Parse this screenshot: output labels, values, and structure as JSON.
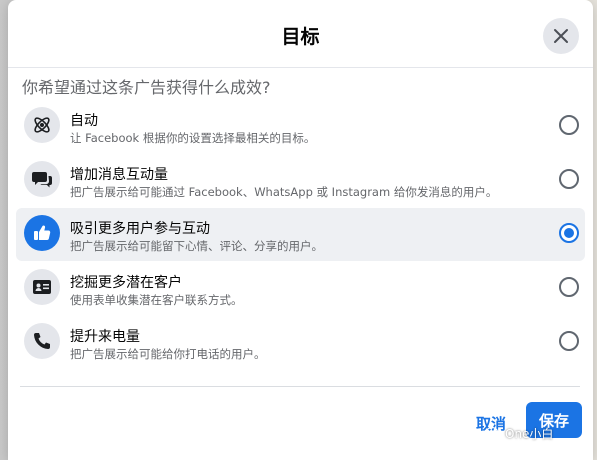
{
  "dialog": {
    "title": "目标",
    "question": "你希望通过这条广告获得什么成效?",
    "cancel_label": "取消",
    "save_label": "保存"
  },
  "options": [
    {
      "title": "自动",
      "desc": "让 Facebook 根据你的设置选择最相关的目标。",
      "icon": "atom-icon",
      "selected": false
    },
    {
      "title": "增加消息互动量",
      "desc": "把广告展示给可能通过 Facebook、WhatsApp 或 Instagram 给你发消息的用户。",
      "icon": "chat-bubbles-icon",
      "selected": false
    },
    {
      "title": "吸引更多用户参与互动",
      "desc": "把广告展示给可能留下心情、评论、分享的用户。",
      "icon": "thumbs-up-icon",
      "selected": true
    },
    {
      "title": "挖掘更多潜在客户",
      "desc": "使用表单收集潜在客户联系方式。",
      "icon": "contact-card-icon",
      "selected": false
    },
    {
      "title": "提升来电量",
      "desc": "把广告展示给可能给你打电话的用户。",
      "icon": "phone-icon",
      "selected": false
    }
  ],
  "watermark": {
    "text": "One小白"
  },
  "colors": {
    "accent": "#1b74e4",
    "selected_bg": "#eef0f3",
    "icon_bg": "#e4e6eb"
  }
}
